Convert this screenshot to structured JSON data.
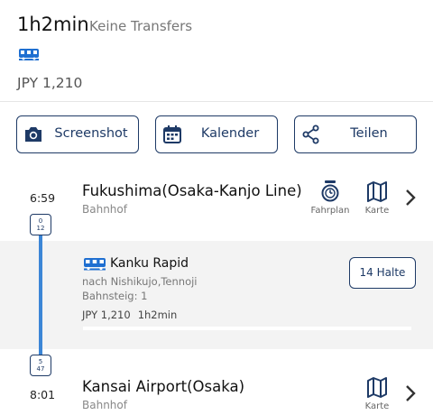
{
  "summary": {
    "duration": "1h2min",
    "transfers": "Keine Transfers",
    "mode_icon": "train-icon",
    "price": "JPY 1,210"
  },
  "actions": {
    "screenshot_label": "Screenshot",
    "calendar_label": "Kalender",
    "share_label": "Teilen"
  },
  "departure": {
    "time": "6:59",
    "platform_top": "0",
    "platform_bottom": "12",
    "station": "Fukushima(Osaka-Kanjo Line)",
    "type": "Bahnhof",
    "timetable_label": "Fahrplan",
    "map_label": "Karte"
  },
  "leg": {
    "train_name": "Kanku Rapid",
    "direction": "nach Nishikujo,Tennoji",
    "platform": "Bahnsteig: 1",
    "price": "JPY 1,210",
    "duration": "1h2min",
    "stops_label": "14 Halte"
  },
  "arrival": {
    "time": "8:01",
    "platform_top": "5",
    "platform_bottom": "47",
    "station": "Kansai Airport(Osaka)",
    "type": "Bahnhof",
    "map_label": "Karte"
  },
  "colors": {
    "accent": "#1e3a66",
    "route_line": "#3c86d6",
    "panel_bg": "#f3f3f3"
  }
}
